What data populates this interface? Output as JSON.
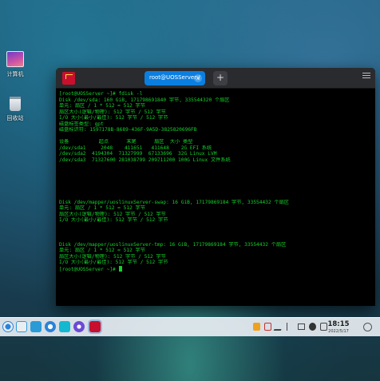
{
  "desktop": {
    "icons": [
      {
        "label": "计算机",
        "icon": "computer-icon"
      },
      {
        "label": "回收站",
        "icon": "trash-icon"
      }
    ]
  },
  "terminal": {
    "tab_title": "root@UOSServer:/",
    "tab_close": "×",
    "add_tab": "+",
    "lines": [
      "[root@UOSServer ~]# fdisk -l",
      "Disk /dev/sda: 160 GiB, 171798691840 字节, 335544320 个扇区",
      "单元: 扇区 / 1 * 512 = 512 字节",
      "扇区大小(逻辑/物理): 512 字节 / 512 字节",
      "I/O 大小(最小/最佳): 512 字节 / 512 字节",
      "磁盘标签类型: gpt",
      "磁盘标识符: 1597178B-8689-436F-9A5D-3825820696FB",
      "",
      "设备          起点      末尾      扇区  大小 类型",
      "/dev/sda1     2048    411651   411648    2G EFI 系统",
      "/dev/sda2  4194304  71327999  67133696  32G Linux LVM",
      "/dev/sda3  71327600 281038799 209711200 100G Linux 文件系统",
      "",
      "",
      "",
      "",
      "",
      "",
      "Disk /dev/mapper/uoslinuxServer-swap: 16 GiB, 17179869184 字节, 33554432 个扇区",
      "单元: 扇区 / 1 * 512 = 512 字节",
      "扇区大小(逻辑/物理): 512 字节 / 512 字节",
      "I/O 大小(最小/最佳): 512 字节 / 512 字节",
      "",
      "",
      "",
      "Disk /dev/mapper/uoslinuxServer-tmp: 16 GiB, 17179869184 字节, 33554432 个扇区",
      "单元: 扇区 / 1 * 512 = 512 字节",
      "扇区大小(逻辑/物理): 512 字节 / 512 字节",
      "I/O 大小(最小/最佳): 512 字节 / 512 字节",
      "[root@UOSServer ~]# "
    ]
  },
  "taskbar": {
    "time": "18:15",
    "date": "2022/5/17",
    "left_icons": [
      "launcher-icon",
      "multitask-icon",
      "file-manager-icon",
      "browser-icon",
      "store-icon",
      "settings-icon",
      "terminal-app-icon"
    ],
    "tray_icons": [
      "power-tray-icon",
      "input-method-icon",
      "edit-tray-icon",
      "bluetooth-icon",
      "display-icon",
      "volume-icon",
      "network-icon"
    ]
  },
  "colors": {
    "terminal_text": "#14d22b",
    "tab_active": "#0b7fe0",
    "app_red": "#c8102e"
  }
}
